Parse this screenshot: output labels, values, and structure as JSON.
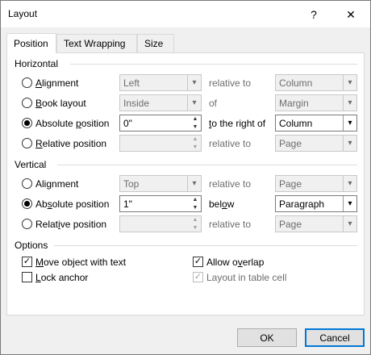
{
  "window": {
    "title": "Layout",
    "help": "?",
    "close": "✕"
  },
  "tabs": [
    {
      "label": "Position",
      "active": true
    },
    {
      "label": "Text Wrapping",
      "active": false
    },
    {
      "label": "Size",
      "active": false
    }
  ],
  "horizontal": {
    "heading": "Horizontal",
    "alignment": {
      "label_u": "A",
      "label_rest": "lignment",
      "value": "Left",
      "relation": "relative to",
      "target": "Column"
    },
    "book": {
      "label_u": "B",
      "label_rest": "ook layout",
      "value": "Inside",
      "relation": "of",
      "target": "Margin"
    },
    "absolute": {
      "label_pre": "Absolute ",
      "label_u": "p",
      "label_rest": "osition",
      "value": "0\"",
      "relation_u": "t",
      "relation_rest": "o the right of",
      "target": "Column"
    },
    "relative": {
      "label_u": "R",
      "label_rest": "elative position",
      "value": "",
      "relation": "relative to",
      "target": "Page"
    }
  },
  "vertical": {
    "heading": "Vertical",
    "alignment": {
      "label_pre": "Ali",
      "label_u": "g",
      "label_rest": "nment",
      "value": "Top",
      "relation": "relative to",
      "target": "Page"
    },
    "absolute": {
      "label_pre": "Ab",
      "label_u": "s",
      "label_rest": "olute position",
      "value": "1\"",
      "relation_pre": "bel",
      "relation_u": "o",
      "relation_rest": "w",
      "target": "Paragraph"
    },
    "relative": {
      "label_pre": "Relat",
      "label_u": "i",
      "label_rest": "ve position",
      "value": "",
      "relation": "relative to",
      "target": "Page"
    }
  },
  "options": {
    "heading": "Options",
    "move_with_text": {
      "label_u": "M",
      "label_rest": "ove object with text",
      "checked": "✓"
    },
    "lock_anchor": {
      "label_u": "L",
      "label_rest": "ock anchor",
      "checked": ""
    },
    "allow_overlap": {
      "label_pre": "Allow o",
      "label_u": "v",
      "label_rest": "erlap",
      "checked": "✓"
    },
    "table_cell": {
      "label": "Layout in table cell",
      "checked": "✓"
    }
  },
  "buttons": {
    "ok": "OK",
    "cancel": "Cancel"
  },
  "icons": {
    "dropdown": "▾",
    "spin_up": "▲",
    "spin_down": "▼"
  }
}
